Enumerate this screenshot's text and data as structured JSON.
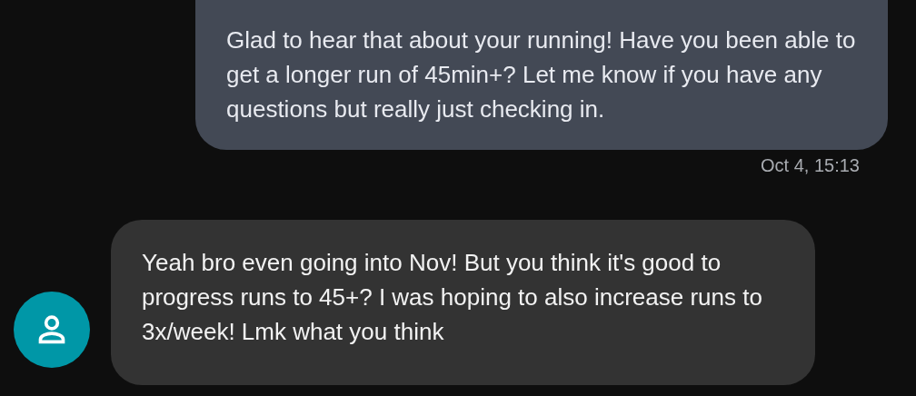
{
  "messages": [
    {
      "kind": "outgoing",
      "text": "Glad to hear that about your running! Have you been able to get a longer run of 45min+? Let me know if you have any questions but really just checking in.",
      "time": "Oct 4, 15:13"
    },
    {
      "kind": "incoming",
      "text": "Yeah bro even going into Nov! But you think it's good to progress runs to 45+? I was hoping to also increase runs to 3x/week! Lmk what you think"
    }
  ]
}
